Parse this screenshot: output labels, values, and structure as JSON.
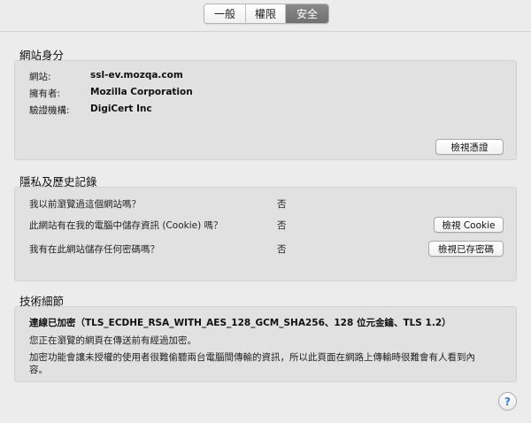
{
  "tabs": [
    {
      "label": "一般",
      "selected": false
    },
    {
      "label": "權限",
      "selected": false
    },
    {
      "label": "安全",
      "selected": true
    }
  ],
  "identity": {
    "title": "網站身分",
    "website_label": "網站:",
    "website_value": "ssl-ev.mozqa.com",
    "owner_label": "擁有者:",
    "owner_value": "Mozilla Corporation",
    "verifier_label": "驗證機構:",
    "verifier_value": "DigiCert Inc",
    "view_cert_button": "檢視憑證"
  },
  "privacy": {
    "title": "隱私及歷史記錄",
    "rows": [
      {
        "question": "我以前瀏覽過這個網站嗎？",
        "answer": "否"
      },
      {
        "question": "此網站有在我的電腦中儲存資訊 (Cookie) 嗎？",
        "answer": "否",
        "button": "檢視 Cookie"
      },
      {
        "question": "我有在此網站儲存任何密碼嗎？",
        "answer": "否",
        "button": "檢視已存密碼"
      }
    ]
  },
  "technical": {
    "title": "技術細節",
    "connection": "連線已加密（TLS_ECDHE_RSA_WITH_AES_128_GCM_SHA256、128 位元金鑰、TLS 1.2）",
    "line1": "您正在瀏覽的網頁在傳送前有經過加密。",
    "line2": "加密功能會讓未授權的使用者很難偷聽兩台電腦間傳輸的資訊，所以此頁面在網路上傳輸時很難會有人看到內",
    "line3": "容。"
  },
  "help": {
    "icon": "help-icon",
    "glyph": "?"
  }
}
